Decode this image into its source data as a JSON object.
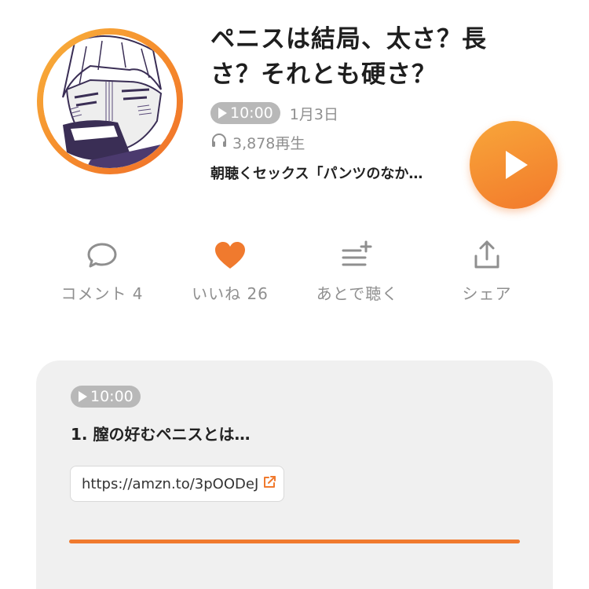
{
  "episode": {
    "title": "ペニスは結局、太さ？長さ？それとも硬さ？",
    "duration": "10:00",
    "date": "1月3日",
    "plays": "3,878再生",
    "show_name": "朝聴くセックス「パンツのなか…",
    "icons": {
      "plays": "headphones-icon",
      "play": "play-icon"
    }
  },
  "actions": [
    {
      "id": "comment",
      "label": "コメント 4",
      "icon": "comment-bubble-icon"
    },
    {
      "id": "like",
      "label": "いいね 26",
      "icon": "heart-icon"
    },
    {
      "id": "later",
      "label": "あとで聴く",
      "icon": "add-to-queue-icon"
    },
    {
      "id": "share",
      "label": "シェア",
      "icon": "share-icon"
    }
  ],
  "chapter": {
    "duration": "10:00",
    "title": "1. 膣の好むペニスとは…",
    "link_text": "https://amzn.to/3pOODeJ",
    "link_icon": "external-link-icon",
    "progress": 1.0
  },
  "colors": {
    "accent": "#f07a2e",
    "badge_gray": "#b8b8b8",
    "muted_text": "#8f8f8f",
    "card_bg": "#f0f0f0"
  }
}
